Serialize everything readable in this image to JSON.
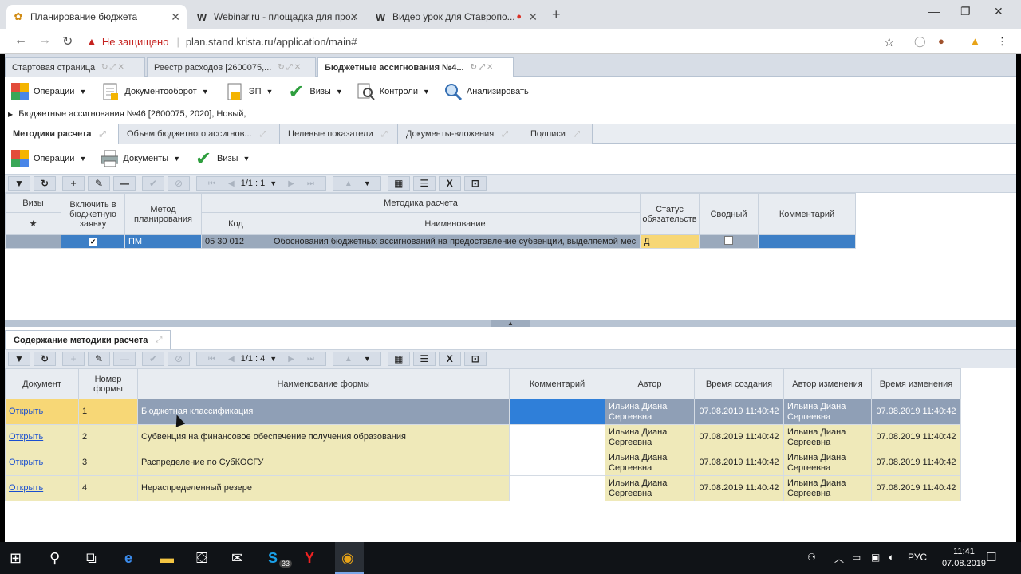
{
  "browser": {
    "tabs": [
      {
        "title": "Планирование бюджета",
        "favicon": "budget-icon",
        "active": true
      },
      {
        "title": "Webinar.ru - площадка для про...",
        "favicon": "W",
        "active": false
      },
      {
        "title": "Видео урок для Ставропо...",
        "favicon": "W",
        "active": false
      }
    ],
    "security_label": "Не защищено",
    "url": "plan.stand.krista.ru/application/main#"
  },
  "app": {
    "tabs": [
      {
        "label": "Стартовая страница"
      },
      {
        "label": "Реестр расходов [2600075,..."
      },
      {
        "label": "Бюджетные ассигнования №4..."
      }
    ],
    "toolbar": {
      "operations": "Операции",
      "docflow": "Документооборот",
      "ep": "ЭП",
      "visas": "Визы",
      "controls": "Контроли",
      "analyze": "Анализировать"
    },
    "breadcrumb": "Бюджетные ассигнования №46 [2600075, 2020], Новый,",
    "subtabs": [
      {
        "label": "Методики расчета"
      },
      {
        "label": "Объем бюджетного ассигнов..."
      },
      {
        "label": "Целевые показатели"
      },
      {
        "label": "Документы-вложения"
      },
      {
        "label": "Подписи"
      }
    ],
    "toolbar2": {
      "operations": "Операции",
      "documents": "Документы",
      "visas": "Визы"
    },
    "pager_top": "1/1 : 1",
    "pager_bottom": "1/1 : 4",
    "top_grid": {
      "headers": {
        "visas": "Визы",
        "include": "Включить в бюджетную заявку",
        "method": "Метод планирования",
        "methodology": "Методика расчета",
        "code": "Код",
        "name": "Наименование",
        "status": "Статус обязательств",
        "summary": "Сводный",
        "comment": "Комментарий"
      },
      "rows": [
        {
          "method": "ПМ",
          "code": "05 30 012",
          "name": "Обоснования бюджетных ассигнований на предоставление субвенции, выделяемой мес",
          "status": "Д"
        }
      ]
    },
    "lower_tab": "Содержание методики расчета",
    "lower_grid": {
      "headers": {
        "document": "Документ",
        "number": "Номер формы",
        "form_name": "Наименование формы",
        "comment": "Комментарий",
        "author": "Автор",
        "created": "Время создания",
        "modified_by": "Автор изменения",
        "modified": "Время изменения"
      },
      "rows": [
        {
          "link": "Открыть",
          "num": "1",
          "name": "Бюджетная классификация",
          "author": "Ильина Диана Сергеевна",
          "created": "07.08.2019 11:40:42",
          "modified_by": "Ильина Диана Сергеевна",
          "modified": "07.08.2019 11:40:42"
        },
        {
          "link": "Открыть",
          "num": "2",
          "name": "Субвенция на финансовое обеспечение получения образования",
          "author": "Ильина Диана Сергеевна",
          "created": "07.08.2019 11:40:42",
          "modified_by": "Ильина Диана Сергеевна",
          "modified": "07.08.2019 11:40:42"
        },
        {
          "link": "Открыть",
          "num": "3",
          "name": "Распределение по СубКОСГУ",
          "author": "Ильина Диана Сергеевна",
          "created": "07.08.2019 11:40:42",
          "modified_by": "Ильина Диана Сергеевна",
          "modified": "07.08.2019 11:40:42"
        },
        {
          "link": "Открыть",
          "num": "4",
          "name": "Нераспределенный резере",
          "author": "Ильина Диана Сергеевна",
          "created": "07.08.2019 11:40:42",
          "modified_by": "Ильина Диана Сергеевна",
          "modified": "07.08.2019 11:40:42"
        }
      ]
    }
  },
  "taskbar": {
    "skype_badge": "33",
    "lang": "РУС",
    "time": "11:41",
    "date": "07.08.2019"
  }
}
